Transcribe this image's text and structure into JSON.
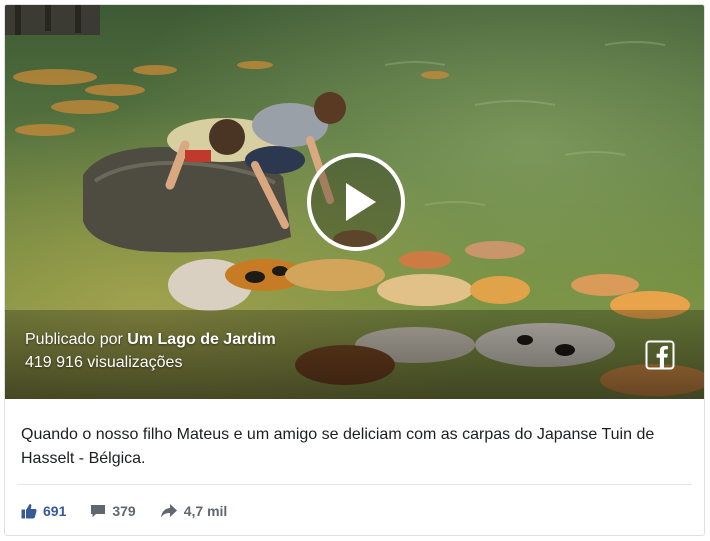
{
  "video": {
    "published_prefix": "Publicado por",
    "page_name": "Um Lago de Jardim",
    "views": "419 916 visualizações"
  },
  "post": {
    "caption": "Quando o nosso filho Mateus e um amigo se deliciam com as carpas do Japanse Tuin de Hasselt - Bélgica."
  },
  "actions": {
    "likes": "691",
    "comments": "379",
    "shares": "4,7 mil"
  },
  "colors": {
    "like_blue": "#385898",
    "meta_gray": "#606770",
    "text": "#1c1e21",
    "border": "#dddfe2"
  },
  "icons": [
    "play-icon",
    "facebook-icon",
    "like-icon",
    "comment-icon",
    "share-icon"
  ]
}
